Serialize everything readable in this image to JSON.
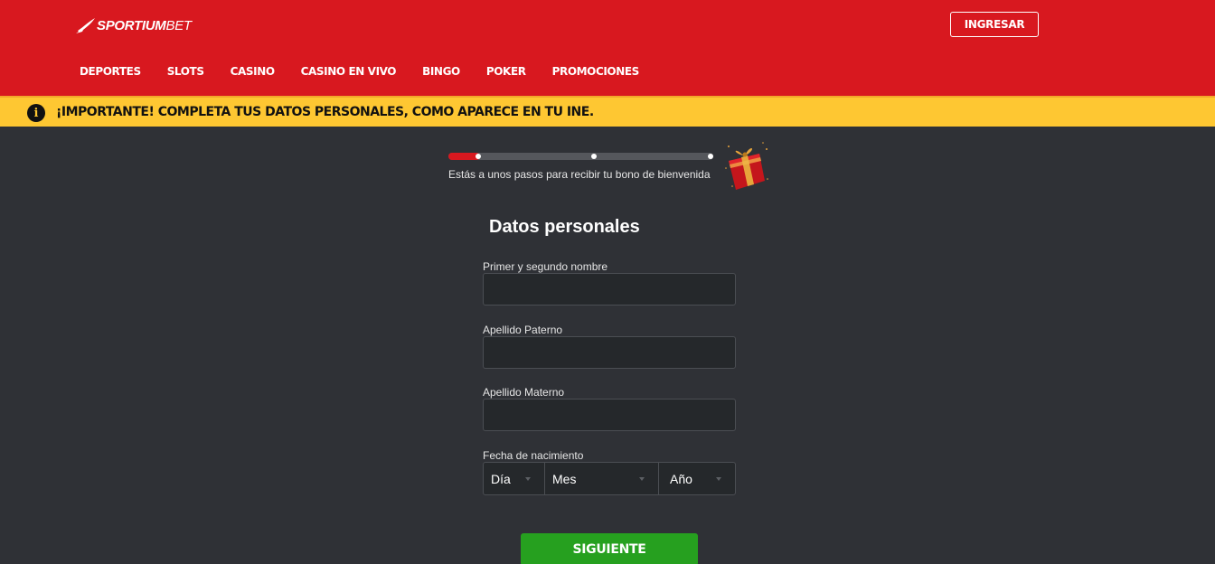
{
  "header": {
    "logo_main": "SPORTIUM",
    "logo_suffix": "BET",
    "login_label": "INGRESAR",
    "nav": [
      "DEPORTES",
      "SLOTS",
      "CASINO",
      "CASINO EN VIVO",
      "BINGO",
      "POKER",
      "PROMOCIONES"
    ]
  },
  "notice": {
    "icon": "info-icon",
    "text": "¡IMPORTANTE! COMPLETA TUS DATOS PERSONALES, COMO APARECE EN TU INE."
  },
  "progress": {
    "fraction": 0.12,
    "steps": 3,
    "current_step": 1,
    "text": "Estás a unos pasos para recibir tu bono de bienvenida",
    "reward_icon": "gift-icon"
  },
  "form": {
    "title": "Datos personales",
    "fields": [
      {
        "label": "Primer y segundo nombre",
        "value": ""
      },
      {
        "label": "Apellido Paterno",
        "value": ""
      },
      {
        "label": "Apellido Materno",
        "value": ""
      }
    ],
    "birthdate": {
      "label": "Fecha de nacimiento",
      "day": "Día",
      "month": "Mes",
      "year": "Año"
    },
    "submit_label": "SIGUIENTE"
  },
  "colors": {
    "brand_red": "#d8181f",
    "notice_yellow": "#fec732",
    "background": "#2f3136",
    "submit_green": "#26a01f"
  }
}
